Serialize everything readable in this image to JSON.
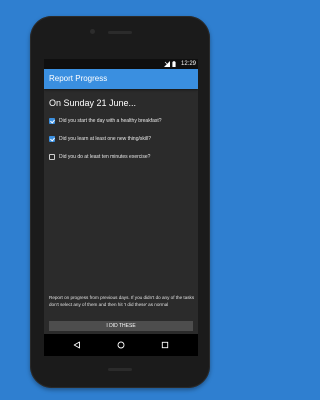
{
  "status_bar": {
    "time": "12:29",
    "icons": [
      "signal-icon",
      "battery-icon"
    ]
  },
  "app_bar": {
    "title": "Report Progress"
  },
  "main": {
    "heading": "On Sunday 21 June...",
    "tasks": [
      {
        "label": "Did you start the day with a healthy breakfast?",
        "checked": true
      },
      {
        "label": "Did you learn at least one new thing/skill?",
        "checked": true
      },
      {
        "label": "Did you do at least ten minutes exercise?",
        "checked": false
      }
    ],
    "footer_text": "Report on progress from previous days. If you didn't do any of the tasks don't select any of them and then hit 'I did these' as normal",
    "done_button_label": "I DID THESE"
  },
  "nav_bar": {
    "icons": [
      "back-icon",
      "home-icon",
      "recents-icon"
    ]
  },
  "colors": {
    "background": "#2f7fd0",
    "app_bar": "#3a8fe0",
    "screen": "#2b2b2b",
    "checkbox_checked": "#3a8fe0"
  }
}
